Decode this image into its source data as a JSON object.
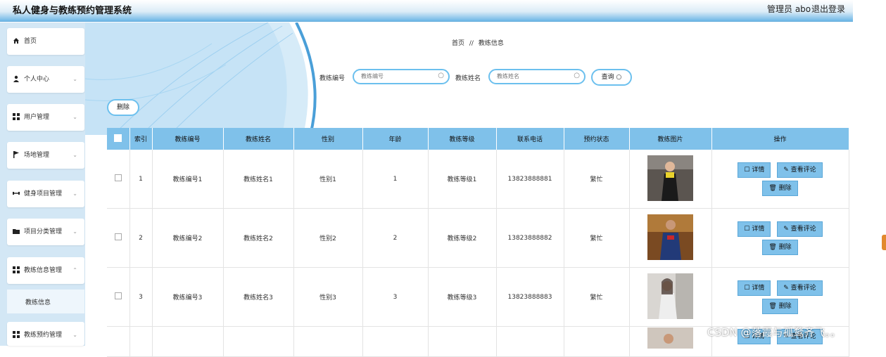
{
  "header": {
    "title": "私人健身与教练预约管理系统",
    "user": "管理员 abo",
    "logout": "退出登录"
  },
  "sidebar": {
    "items": [
      {
        "label": "首页",
        "icon": "home-icon"
      },
      {
        "label": "个人中心",
        "icon": "person-icon"
      },
      {
        "label": "用户管理",
        "icon": "grid-icon"
      },
      {
        "label": "场地管理",
        "icon": "flag-icon"
      },
      {
        "label": "健身项目管理",
        "icon": "dumbbell-icon"
      },
      {
        "label": "项目分类管理",
        "icon": "folder-icon"
      },
      {
        "label": "教练信息管理",
        "icon": "grid-icon"
      }
    ],
    "sub_item": "教练信息",
    "bottom_item": "教练预约管理"
  },
  "breadcrumb": {
    "home": "首页",
    "separator": "//",
    "current": "教练信息"
  },
  "search": {
    "no_label": "教练编号",
    "no_placeholder": "教练编号",
    "name_label": "教练姓名",
    "name_placeholder": "教练姓名",
    "query_label": "查询"
  },
  "delete_button": "删除",
  "table": {
    "columns": [
      "索引",
      "教练编号",
      "教练姓名",
      "性别",
      "年龄",
      "教练等级",
      "联系电话",
      "预约状态",
      "教练图片",
      "操作"
    ],
    "rows": [
      {
        "index": "1",
        "no": "教练编号1",
        "name": "教练姓名1",
        "gender": "性别1",
        "age": "1",
        "level": "教练等级1",
        "phone": "13823888881",
        "status": "繁忙"
      },
      {
        "index": "2",
        "no": "教练编号2",
        "name": "教练姓名2",
        "gender": "性别2",
        "age": "2",
        "level": "教练等级2",
        "phone": "13823888882",
        "status": "繁忙"
      },
      {
        "index": "3",
        "no": "教练编号3",
        "name": "教练姓名3",
        "gender": "性别3",
        "age": "3",
        "level": "教练等级3",
        "phone": "13823888883",
        "status": "繁忙"
      }
    ],
    "actions": {
      "detail": "详情",
      "comment": "查看评论",
      "delete": "删除"
    }
  },
  "watermark": "CSDN @落霞与孤鹜齐飞。。",
  "colors": {
    "accent": "#7fc1ea",
    "sidebar_bg": "#d3e7f5",
    "border": "#6cc0ee"
  }
}
